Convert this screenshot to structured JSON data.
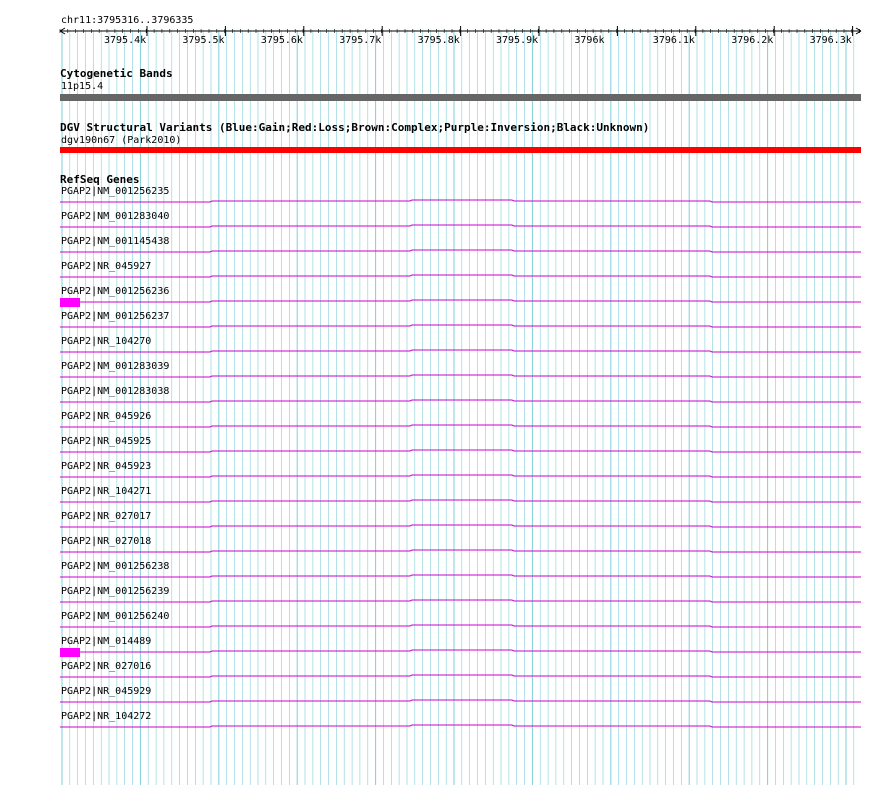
{
  "ruler": {
    "range_label": "chr11:3795316..3796335",
    "ticks": [
      "3795.4k",
      "3795.5k",
      "3795.6k",
      "3795.7k",
      "3795.8k",
      "3795.9k",
      "3796k",
      "3796.1k",
      "3796.2k",
      "3796.3k"
    ]
  },
  "tracks": {
    "cytoband": {
      "title": "Cytogenetic Bands",
      "band": "11p15.4",
      "color": "#666666"
    },
    "dgv": {
      "title": "DGV Structural Variants (Blue:Gain;Red:Loss;Brown:Complex;Purple:Inversion;Black:Unknown)",
      "feature": "dgv190n67 (Park2010)",
      "color": "#ff0000"
    },
    "refseq": {
      "title": "RefSeq Genes",
      "color": "#cc00cc",
      "exon_color": "#ff00ff",
      "genes": [
        {
          "label": "PGAP2|NM_001256235",
          "exon": false
        },
        {
          "label": "PGAP2|NM_001283040",
          "exon": false
        },
        {
          "label": "PGAP2|NM_001145438",
          "exon": false
        },
        {
          "label": "PGAP2|NR_045927",
          "exon": false
        },
        {
          "label": "PGAP2|NM_001256236",
          "exon": true
        },
        {
          "label": "PGAP2|NM_001256237",
          "exon": false
        },
        {
          "label": "PGAP2|NR_104270",
          "exon": false
        },
        {
          "label": "PGAP2|NM_001283039",
          "exon": false
        },
        {
          "label": "PGAP2|NM_001283038",
          "exon": false
        },
        {
          "label": "PGAP2|NR_045926",
          "exon": false
        },
        {
          "label": "PGAP2|NR_045925",
          "exon": false
        },
        {
          "label": "PGAP2|NR_045923",
          "exon": false
        },
        {
          "label": "PGAP2|NR_104271",
          "exon": false
        },
        {
          "label": "PGAP2|NR_027017",
          "exon": false
        },
        {
          "label": "PGAP2|NR_027018",
          "exon": false
        },
        {
          "label": "PGAP2|NM_001256238",
          "exon": false
        },
        {
          "label": "PGAP2|NM_001256239",
          "exon": false
        },
        {
          "label": "PGAP2|NM_001256240",
          "exon": false
        },
        {
          "label": "PGAP2|NM_014489",
          "exon": true
        },
        {
          "label": "PGAP2|NR_027016",
          "exon": false
        },
        {
          "label": "PGAP2|NR_045929",
          "exon": false
        },
        {
          "label": "PGAP2|NR_104272",
          "exon": false
        }
      ]
    }
  },
  "colors": {
    "grid": "#7fcfd8",
    "ruler": "#000000"
  }
}
